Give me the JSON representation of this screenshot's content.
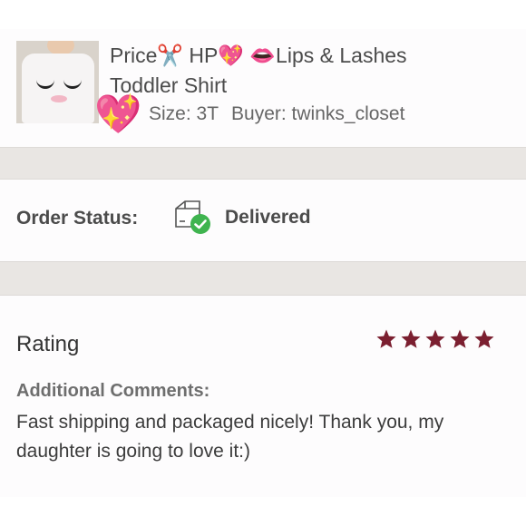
{
  "listing": {
    "title_line1": "Price✂️ HP💖 👄Lips & Lashes",
    "title_line2": "Toddler Shirt",
    "size": "Size: 3T",
    "buyer": "Buyer: twinks_closet",
    "sticker_icon": "sparkling-heart-icon",
    "sticker_glyph": "💖"
  },
  "order": {
    "status_label": "Order Status:",
    "status_value": "Delivered",
    "status_icon": "box-check-icon",
    "status_color": "#3fb44f"
  },
  "rating": {
    "label": "Rating",
    "stars": 5,
    "max_stars": 5,
    "star_color": "#7b1f30",
    "comments_label": "Additional Comments:",
    "comments_text": "Fast shipping and packaged nicely! Thank you, my daughter is going to love it:)"
  }
}
